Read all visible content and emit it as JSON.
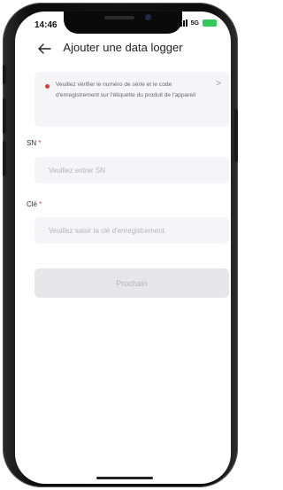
{
  "status_bar": {
    "time": "14:46",
    "network": "5G",
    "battery": ""
  },
  "header": {
    "title": "Ajouter une data logger"
  },
  "notice": {
    "text": "Veuillez vérifier le numéro de série et le code d'enregistrement sur l'étiquette du produit de l'appareil"
  },
  "sn_field": {
    "label": "SN",
    "required_mark": "*",
    "placeholder": "Veuillez entrer SN",
    "value": ""
  },
  "key_field": {
    "label": "Clé",
    "required_mark": "*",
    "placeholder": "Veuillez saisir la clé d'enregistrement",
    "value": ""
  },
  "next_button": {
    "label": "Prochain"
  },
  "colors": {
    "required": "#e53935",
    "battery": "#34c759",
    "disabled_button": "#e7e7ea"
  }
}
